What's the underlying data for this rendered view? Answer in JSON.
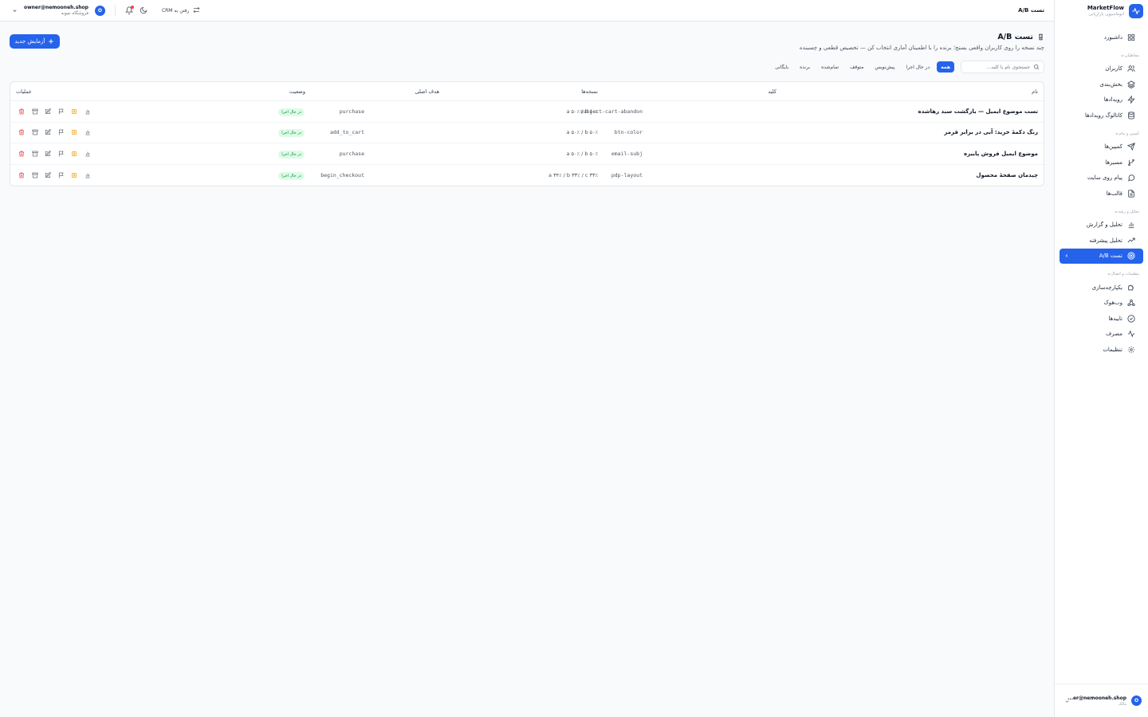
{
  "brand": {
    "name": "MarketFlow",
    "subtitle": "اتوماسیون بازاریابی"
  },
  "sidebar": {
    "items": [
      {
        "label": "داشبورد",
        "icon": "dashboard-icon"
      },
      {
        "group": "مخاطبان"
      },
      {
        "label": "کاربران",
        "icon": "users-icon"
      },
      {
        "label": "بخش‌بندی",
        "icon": "layers-icon"
      },
      {
        "label": "رویدادها",
        "icon": "bolt-icon"
      },
      {
        "label": "کاتالوگ رویدادها",
        "icon": "database-icon"
      },
      {
        "group": "کمپین و پیام"
      },
      {
        "label": "کمپین‌ها",
        "icon": "send-icon"
      },
      {
        "label": "مسیرها",
        "icon": "branch-icon"
      },
      {
        "label": "پیام روی سایت",
        "icon": "message-icon"
      },
      {
        "label": "قالب‌ها",
        "icon": "file-icon"
      },
      {
        "group": "تحلیل و رشد"
      },
      {
        "label": "تحلیل و گزارش",
        "icon": "bar-chart-icon"
      },
      {
        "label": "تحلیل پیشرفته",
        "icon": "trending-icon"
      },
      {
        "label": "تست A/B",
        "icon": "target-icon",
        "active": true
      },
      {
        "group": "تنظیمات و اتصال"
      },
      {
        "label": "یکپارچه‌سازی",
        "icon": "puzzle-icon"
      },
      {
        "label": "وب‌هوک",
        "icon": "webhook-icon"
      },
      {
        "label": "تاییدها",
        "icon": "check-circle-icon"
      },
      {
        "label": "مصرف",
        "icon": "activity-icon"
      },
      {
        "label": "تنظیمات",
        "icon": "gear-icon"
      }
    ],
    "footer": {
      "avatar": "O",
      "email": "...er@nemooneh.shop",
      "role": "مالک"
    }
  },
  "topbar": {
    "title": "تست A/B",
    "crm_label": "رفتن به CRM",
    "account": {
      "avatar": "O",
      "email": "owner@nemooneh.shop",
      "store": "فروشگاه نمونه"
    }
  },
  "page": {
    "title": "تست A/B",
    "subtitle": "چند نسخه را روی کاربران واقعی بسنج؛ برنده را با اطمینان آماری انتخاب کن — تخصیص قطعی و چسبنده",
    "new_button": "آزمایش جدید"
  },
  "search": {
    "placeholder": "جستجوی نام یا کلید..."
  },
  "filters": [
    "همه",
    "در حال اجرا",
    "پیش‌نویس",
    "متوقف",
    "تمام‌شده",
    "برنده",
    "بایگانی"
  ],
  "table": {
    "headers": {
      "name": "نام",
      "key": "کلید",
      "variants": "نسخه‌ها",
      "goal": "هدف اصلی",
      "status": "وضعیت",
      "actions": "عملیات"
    },
    "rows": [
      {
        "name": "تست موضوع ایمیل — بازگشت سبد رهاشده",
        "key": "subject-cart-abandon",
        "variants": "a ۵۰٪ / b ۵۰٪",
        "goal": "purchase",
        "status": "در حال اجرا"
      },
      {
        "name": "رنگ دکمهٔ خرید: آبی در برابر قرمز",
        "key": "btn-color",
        "variants": "a ۵۰٪ / b ۵۰٪",
        "goal": "add_to_cart",
        "status": "در حال اجرا"
      },
      {
        "name": "موضوع ایمیل فروش پاییزه",
        "key": "email-subj",
        "variants": "a ۵۰٪ / b ۵۰٪",
        "goal": "purchase",
        "status": "در حال اجرا"
      },
      {
        "name": "چیدمان صفحهٔ محصول",
        "key": "pdp-layout",
        "variants": "a ۳۴٪ / b ۳۳٪ / c ۳۳٪",
        "goal": "begin_checkout",
        "status": "در حال اجرا"
      }
    ]
  },
  "colors": {
    "accent": "#2563eb",
    "status_running_bg": "#dcfce7",
    "status_running_text": "#15803d",
    "delete": "#ef4444",
    "winner": "#f59e0b"
  }
}
